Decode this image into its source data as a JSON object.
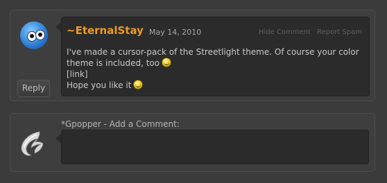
{
  "comment": {
    "author": "~EternalStay",
    "date": "May 14, 2010",
    "actions": [
      "Hide Comment",
      "Report Spam"
    ],
    "lines": [
      "I've made a cursor-pack of the Streetlight theme. Of course your color theme is included, too",
      "[link]",
      "Hope you like it"
    ],
    "reply_label": "Reply",
    "colors": {
      "author": "#ee9a25"
    }
  },
  "compose": {
    "title": "*Gpopper - Add a Comment:",
    "value": ""
  }
}
